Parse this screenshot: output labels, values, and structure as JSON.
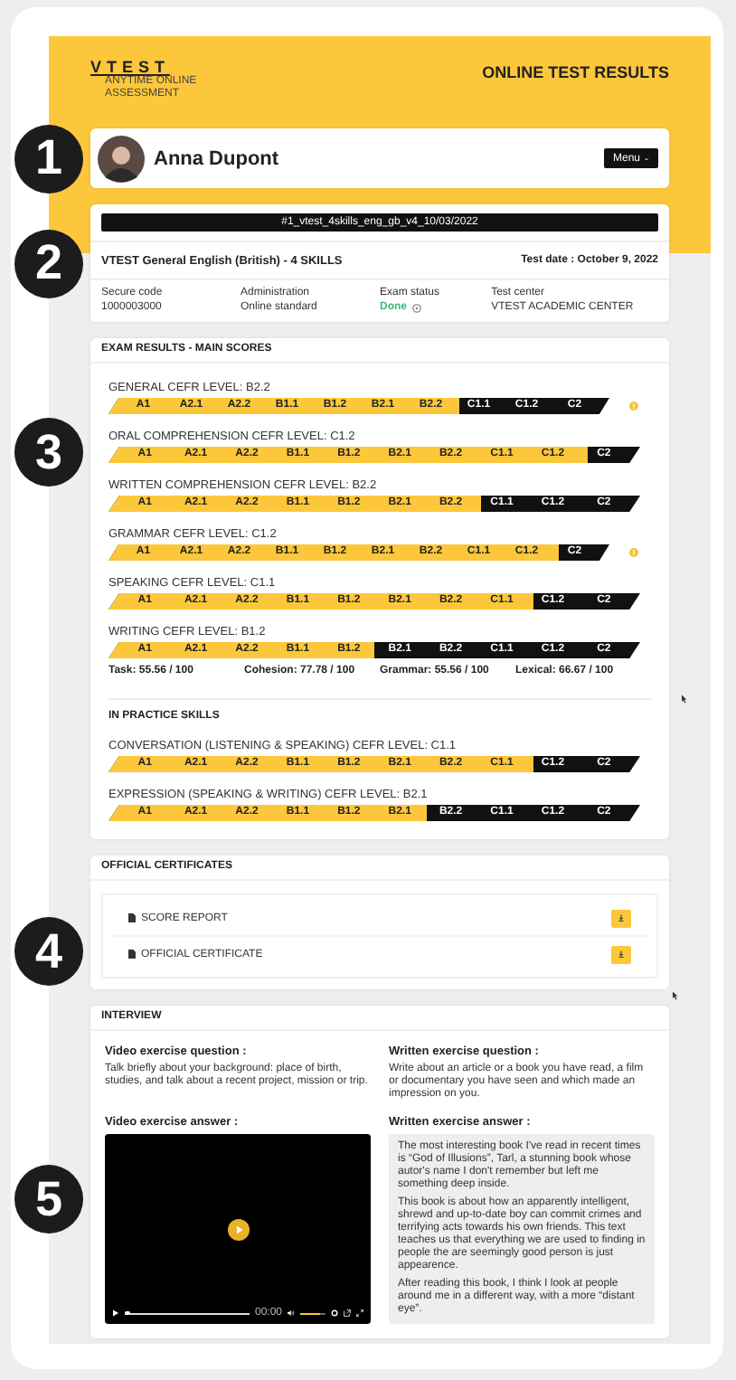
{
  "header": {
    "logo": "VTEST",
    "tagline": [
      "ANYTIME ONLINE",
      "ASSESSMENT"
    ],
    "title": "ONLINE TEST RESULTS"
  },
  "candidate": {
    "callout": "1",
    "name": "Anna Dupont",
    "menu": "Menu"
  },
  "test": {
    "callout": "2",
    "reference": "#1_vtest_4skills_eng_gb_v4_10/03/2022",
    "name": "VTEST General English (British) - 4 SKILLS",
    "date": "Test date : October 9, 2022",
    "details": [
      {
        "kind": "text",
        "label": "Secure code",
        "value": "1000003000"
      },
      {
        "kind": "text",
        "label": "Administration",
        "value": "Online standard"
      },
      {
        "kind": "status",
        "label": "Exam status",
        "value": "Done"
      },
      {
        "kind": "text",
        "label": "Test center",
        "value": "VTEST ACADEMIC CENTER"
      }
    ]
  },
  "exam_results": {
    "callout": "3",
    "title": "EXAM RESULTS - MAIN SCORES",
    "skills": [
      {
        "label": "GENERAL CEFR LEVEL:  B2.2",
        "info": true,
        "level": 0.7,
        "segments": [
          "A1",
          "A2.1",
          "A2.2",
          "B1.1",
          "B1.2",
          "B2.1",
          "B2.2",
          "C1.1",
          "C1.2",
          "C2"
        ]
      },
      {
        "label": "ORAL COMPREHENSION CEFR LEVEL:  C1.2",
        "info": false,
        "level": 0.9,
        "segments": [
          "A1",
          "A2.1",
          "A2.2",
          "B1.1",
          "B1.2",
          "B2.1",
          "B2.2",
          "C1.1",
          "C1.2",
          "C2"
        ]
      },
      {
        "label": "WRITTEN COMPREHENSION CEFR LEVEL:  B2.2",
        "info": false,
        "level": 0.7,
        "segments": [
          "A1",
          "A2.1",
          "A2.2",
          "B1.1",
          "B1.2",
          "B2.1",
          "B2.2",
          "C1.1",
          "C1.2",
          "C2"
        ]
      },
      {
        "label": "GRAMMAR CEFR LEVEL:  C1.2",
        "info": true,
        "level": 0.9,
        "segments": [
          "A1",
          "A2.1",
          "A2.2",
          "B1.1",
          "B1.2",
          "B2.1",
          "B2.2",
          "C1.1",
          "C1.2",
          "C2"
        ]
      },
      {
        "label": "SPEAKING CEFR LEVEL:  C1.1",
        "info": false,
        "level": 0.8,
        "segments": [
          "A1",
          "A2.1",
          "A2.2",
          "B1.1",
          "B1.2",
          "B2.1",
          "B2.2",
          "C1.1",
          "C1.2",
          "C2"
        ]
      },
      {
        "label": "WRITING CEFR LEVEL:  B1.2",
        "info": false,
        "level": 0.5,
        "segments": [
          "A1",
          "A2.1",
          "A2.2",
          "B1.1",
          "B1.2",
          "B2.1",
          "B2.2",
          "C1.1",
          "C1.2",
          "C2"
        ],
        "subscores": [
          "Task: 55.56 / 100",
          "Cohesion: 77.78 / 100",
          "Grammar: 55.56 / 100",
          "Lexical: 66.67 / 100"
        ]
      }
    ],
    "practice_title": "IN PRACTICE SKILLS",
    "practice_skills": [
      {
        "label": "CONVERSATION (LISTENING & SPEAKING) CEFR LEVEL:  C1.1",
        "info": false,
        "level": 0.8,
        "segments": [
          "A1",
          "A2.1",
          "A2.2",
          "B1.1",
          "B1.2",
          "B2.1",
          "B2.2",
          "C1.1",
          "C1.2",
          "C2"
        ]
      },
      {
        "label": "EXPRESSION (SPEAKING & WRITING) CEFR LEVEL:  B2.1",
        "info": false,
        "level": 0.6,
        "segments": [
          "A1",
          "A2.1",
          "A2.2",
          "B1.1",
          "B1.2",
          "B2.1",
          "B2.2",
          "C1.1",
          "C1.2",
          "C2"
        ]
      }
    ]
  },
  "certificates": {
    "callout": "4",
    "title": "OFFICIAL CERTIFICATES",
    "items": [
      "SCORE REPORT",
      "OFFICIAL CERTIFICATE"
    ]
  },
  "interview": {
    "callout": "5",
    "title": "INTERVIEW",
    "video_question": {
      "label": "Video exercise question :",
      "text": "Talk briefly about your background: place of birth, studies, and talk about a recent project, mission or trip."
    },
    "written_question": {
      "label": "Written exercise question :",
      "text": "Write about an article or a book you have read, a film or documentary you have seen and which made an impression on you."
    },
    "video_answer": {
      "label": "Video exercise answer :",
      "time": "00:00",
      "progress": {
        "level": 0
      },
      "volume": {
        "level": 0.8
      }
    },
    "written_answer": {
      "label": "Written exercise answer :",
      "paragraphs": [
        "The most interesting book I've read in recent times is “God of Illusions”, Tarl, a stunning book whose autor's name I don't remember but left me something deep inside.",
        "This book is about how an apparently intelligent, shrewd and up-to-date boy can commit crimes and terrifying acts towards his own friends. This text teaches us that everything we are used to finding in people the are seemingly good person is just appearence.",
        "After reading this book, I think I look at people around me in a different way, with a more “distant eye”."
      ]
    }
  }
}
